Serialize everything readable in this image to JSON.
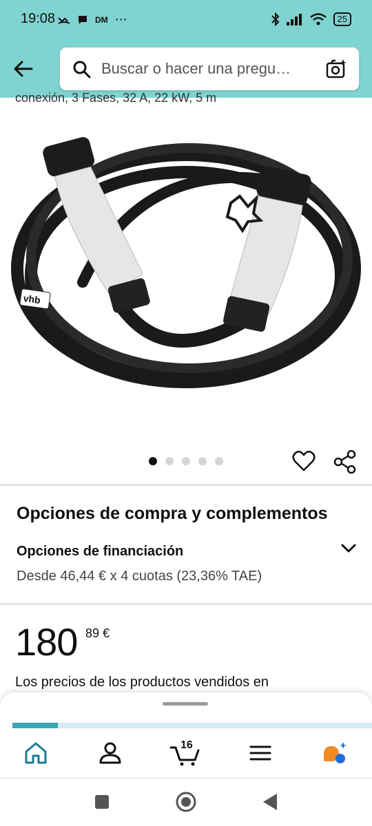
{
  "status_bar": {
    "time": "19:08",
    "carrier_tag": "DM",
    "more": "⋯",
    "battery": "25"
  },
  "search": {
    "placeholder": "Buscar o hacer una pregu…"
  },
  "product": {
    "title_fragment": "conexión, 3 Fases, 32 A, 22 kW, 5 m",
    "image_brand_label": "vhb",
    "carousel": {
      "total": 5,
      "active": 0
    }
  },
  "purchase_options": {
    "section_title": "Opciones de compra y complementos",
    "financing_title": "Opciones de financiación",
    "financing_desc": "Desde 46,44 € x 4 cuotas (23,36% TAE)"
  },
  "price": {
    "whole": "180",
    "fraction_currency": "89 €",
    "note": "Los precios de los productos vendidos en"
  },
  "bottom_nav": {
    "cart_count": "16"
  },
  "colors": {
    "header_bg": "#7fd3d0",
    "accent": "#3aa6b9",
    "assistant_orange": "#f08a24",
    "assistant_blue": "#1e6fd9"
  }
}
